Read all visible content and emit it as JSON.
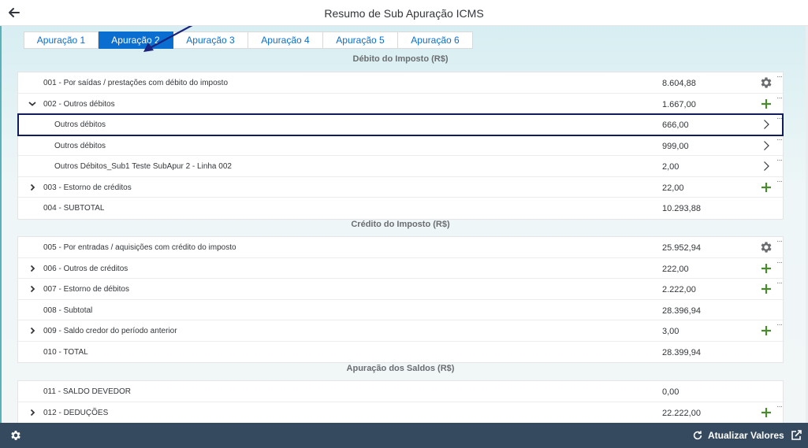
{
  "header": {
    "title": "Resumo de Sub Apuração ICMS"
  },
  "tabs": [
    {
      "label": "Apuração 1"
    },
    {
      "label": "Apuração 2"
    },
    {
      "label": "Apuração 3"
    },
    {
      "label": "Apuração 4"
    },
    {
      "label": "Apuração 5"
    },
    {
      "label": "Apuração 6"
    }
  ],
  "sections": {
    "debito": {
      "title": "Débito do Imposto (R$)",
      "rows": [
        {
          "label": "001 - Por saídas / prestações com débito do imposto",
          "value": "8.604,88"
        },
        {
          "label": "002 - Outros débitos",
          "value": "1.667,00"
        },
        {
          "label": "Outros débitos",
          "value": "666,00"
        },
        {
          "label": "Outros débitos",
          "value": "999,00"
        },
        {
          "label": "Outros Débitos_Sub1 Teste SubApur 2 - Linha 002",
          "value": "2,00"
        },
        {
          "label": "003 - Estorno de créditos",
          "value": "22,00"
        },
        {
          "label": "004 - SUBTOTAL",
          "value": "10.293,88"
        }
      ]
    },
    "credito": {
      "title": "Crédito do Imposto (R$)",
      "rows": [
        {
          "label": "005 - Por entradas / aquisições com crédito do imposto",
          "value": "25.952,94"
        },
        {
          "label": "006 - Outros de créditos",
          "value": "222,00"
        },
        {
          "label": "007 - Estorno de débitos",
          "value": "2.222,00"
        },
        {
          "label": "008 - Subtotal",
          "value": "28.396,94"
        },
        {
          "label": "009 - Saldo credor do período anterior",
          "value": "3,00"
        },
        {
          "label": "010 - TOTAL",
          "value": "28.399,94"
        }
      ]
    },
    "saldos": {
      "title": "Apuração dos Saldos (R$)",
      "rows": [
        {
          "label": "011 - SALDO DEVEDOR",
          "value": "0,00"
        },
        {
          "label": "012 - DEDUÇÕES",
          "value": "22.222,00"
        }
      ]
    }
  },
  "footer": {
    "refresh_label": "Atualizar Valores"
  },
  "icons": {
    "back": "arrow-left-icon",
    "settings": "gear-icon",
    "add": "plus-icon",
    "navigate": "chevron-right-icon",
    "expand": "chevron-right-small-icon",
    "collapse": "chevron-down-small-icon",
    "more": "more-icon",
    "refresh": "refresh-icon",
    "share": "share-icon"
  },
  "colors": {
    "accent": "#0a6ed1",
    "add_green": "#4c8a2f",
    "footer_bg": "#354a5f",
    "selected_outline": "#111c5c",
    "annotation_arrow": "#1a237e"
  }
}
